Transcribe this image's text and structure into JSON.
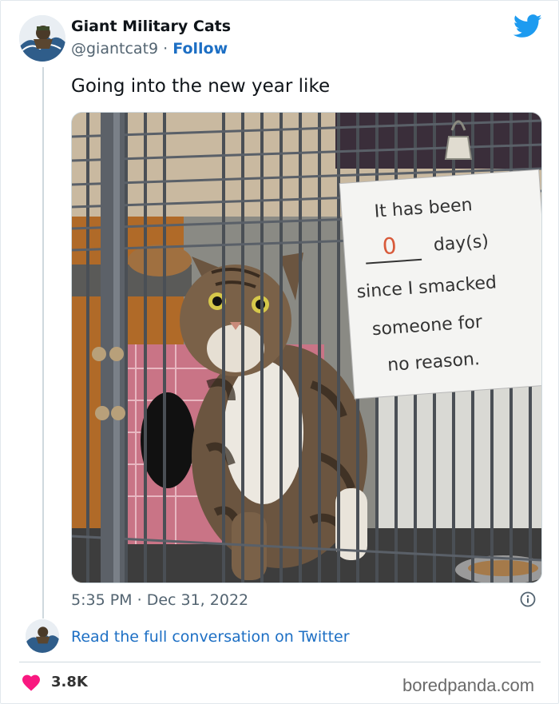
{
  "tweet": {
    "author_name": "Giant Military Cats",
    "author_handle": "@giantcat9",
    "separator": "·",
    "follow_label": "Follow",
    "text": "Going into the new year like",
    "time": "5:35 PM",
    "date": "Dec 31, 2022",
    "read_conversation_label": "Read the full conversation on Twitter",
    "likes_count": "3.8K"
  },
  "sign": {
    "line1": "It has been",
    "count": "0",
    "line2": "day(s)",
    "line3": "since I smacked",
    "line4": "someone for",
    "line5": "no reason."
  },
  "watermark": "boredpanda.com",
  "colors": {
    "link": "#1d6fc4",
    "twitter_blue": "#1d9bf0",
    "heart": "#f91880",
    "sign_marker": "#d85a3a"
  },
  "icons": [
    "twitter-bird-icon",
    "info-icon",
    "heart-icon"
  ]
}
